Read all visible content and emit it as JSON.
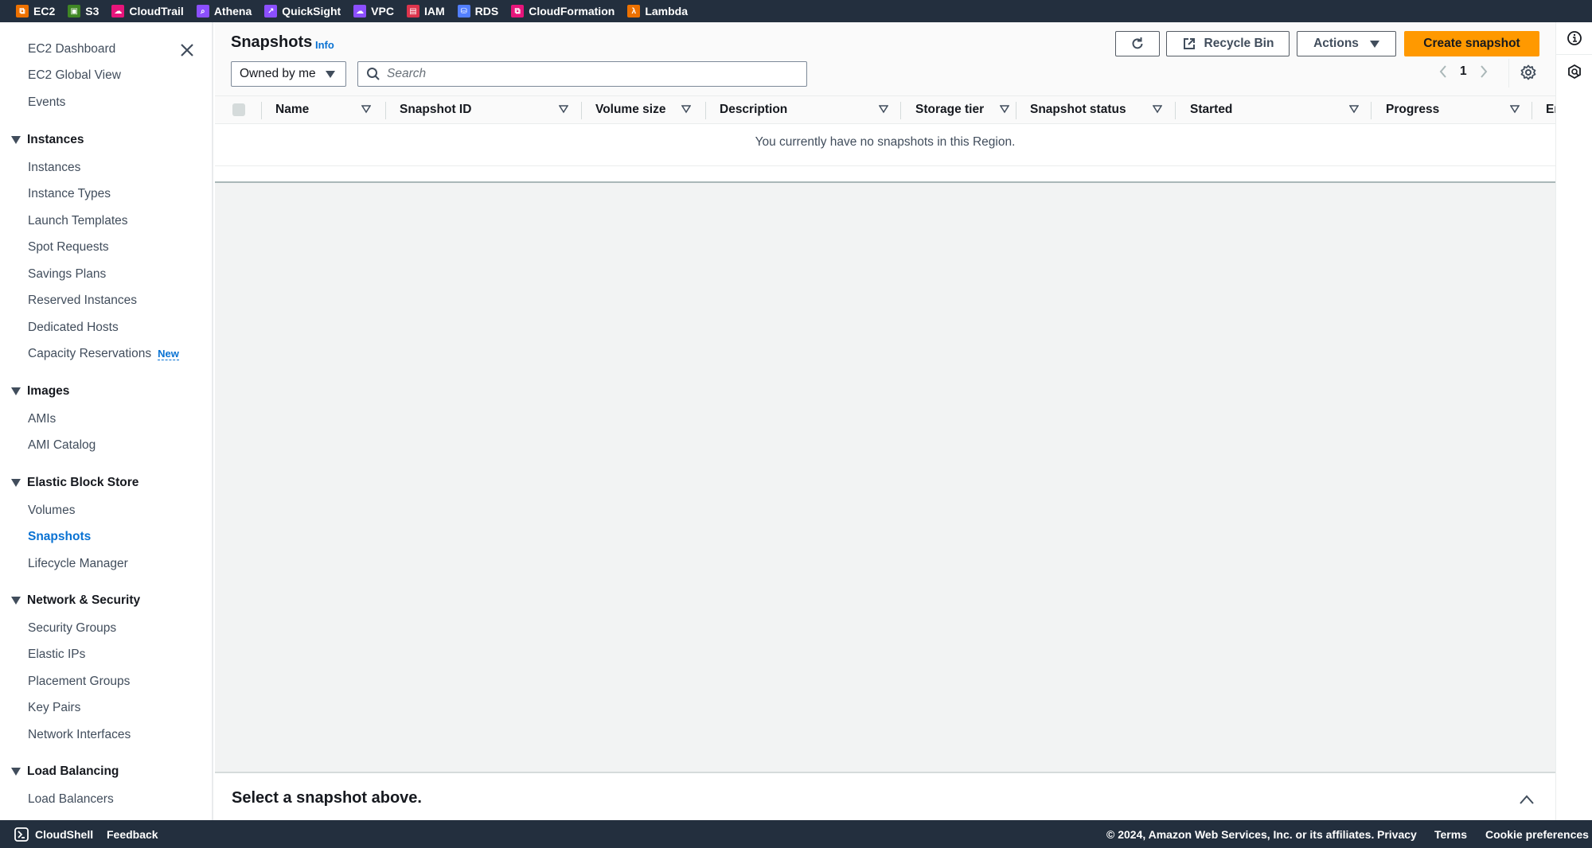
{
  "favorites_bar": [
    {
      "label": "EC2",
      "icon": "ec2-icon",
      "color": "#ed7100"
    },
    {
      "label": "S3",
      "icon": "s3-icon",
      "color": "#3f8624"
    },
    {
      "label": "CloudTrail",
      "icon": "cloudtrail-icon",
      "color": "#e7157b"
    },
    {
      "label": "Athena",
      "icon": "athena-icon",
      "color": "#8c4fff"
    },
    {
      "label": "QuickSight",
      "icon": "quicksight-icon",
      "color": "#8c4fff"
    },
    {
      "label": "VPC",
      "icon": "vpc-icon",
      "color": "#8c4fff"
    },
    {
      "label": "IAM",
      "icon": "iam-icon",
      "color": "#dd344c"
    },
    {
      "label": "RDS",
      "icon": "rds-icon",
      "color": "#527fff"
    },
    {
      "label": "CloudFormation",
      "icon": "cloudformation-icon",
      "color": "#e7157b"
    },
    {
      "label": "Lambda",
      "icon": "lambda-icon",
      "color": "#ed7100"
    }
  ],
  "sidebar": {
    "top_items": [
      "EC2 Dashboard",
      "EC2 Global View",
      "Events"
    ],
    "sections": [
      {
        "title": "Instances",
        "items": [
          "Instances",
          "Instance Types",
          "Launch Templates",
          "Spot Requests",
          "Savings Plans",
          "Reserved Instances",
          "Dedicated Hosts",
          "Capacity Reservations"
        ]
      },
      {
        "title": "Images",
        "items": [
          "AMIs",
          "AMI Catalog"
        ]
      },
      {
        "title": "Elastic Block Store",
        "items": [
          "Volumes",
          "Snapshots",
          "Lifecycle Manager"
        ]
      },
      {
        "title": "Network & Security",
        "items": [
          "Security Groups",
          "Elastic IPs",
          "Placement Groups",
          "Key Pairs",
          "Network Interfaces"
        ]
      },
      {
        "title": "Load Balancing",
        "items": [
          "Load Balancers"
        ]
      }
    ],
    "new_badge": "New",
    "active_item": "Snapshots"
  },
  "page": {
    "title": "Snapshots",
    "info_label": "Info",
    "buttons": {
      "recycle_bin": "Recycle Bin",
      "actions": "Actions",
      "create": "Create snapshot"
    },
    "filter_select": "Owned by me",
    "search_placeholder": "Search",
    "current_page": "1",
    "columns": [
      "Name",
      "Snapshot ID",
      "Volume size",
      "Description",
      "Storage tier",
      "Snapshot status",
      "Started",
      "Progress",
      "En"
    ],
    "empty_message": "You currently have no snapshots in this Region.",
    "split_panel_title": "Select a snapshot above."
  },
  "footer": {
    "cloudshell": "CloudShell",
    "feedback": "Feedback",
    "copyright": "© 2024, Amazon Web Services, Inc. or its affiliates.",
    "privacy": "Privacy",
    "terms": "Terms",
    "cookie": "Cookie preferences"
  },
  "colors": {
    "primary": "#ff9900",
    "link": "#0972d3",
    "nav_dark": "#232f3e"
  }
}
